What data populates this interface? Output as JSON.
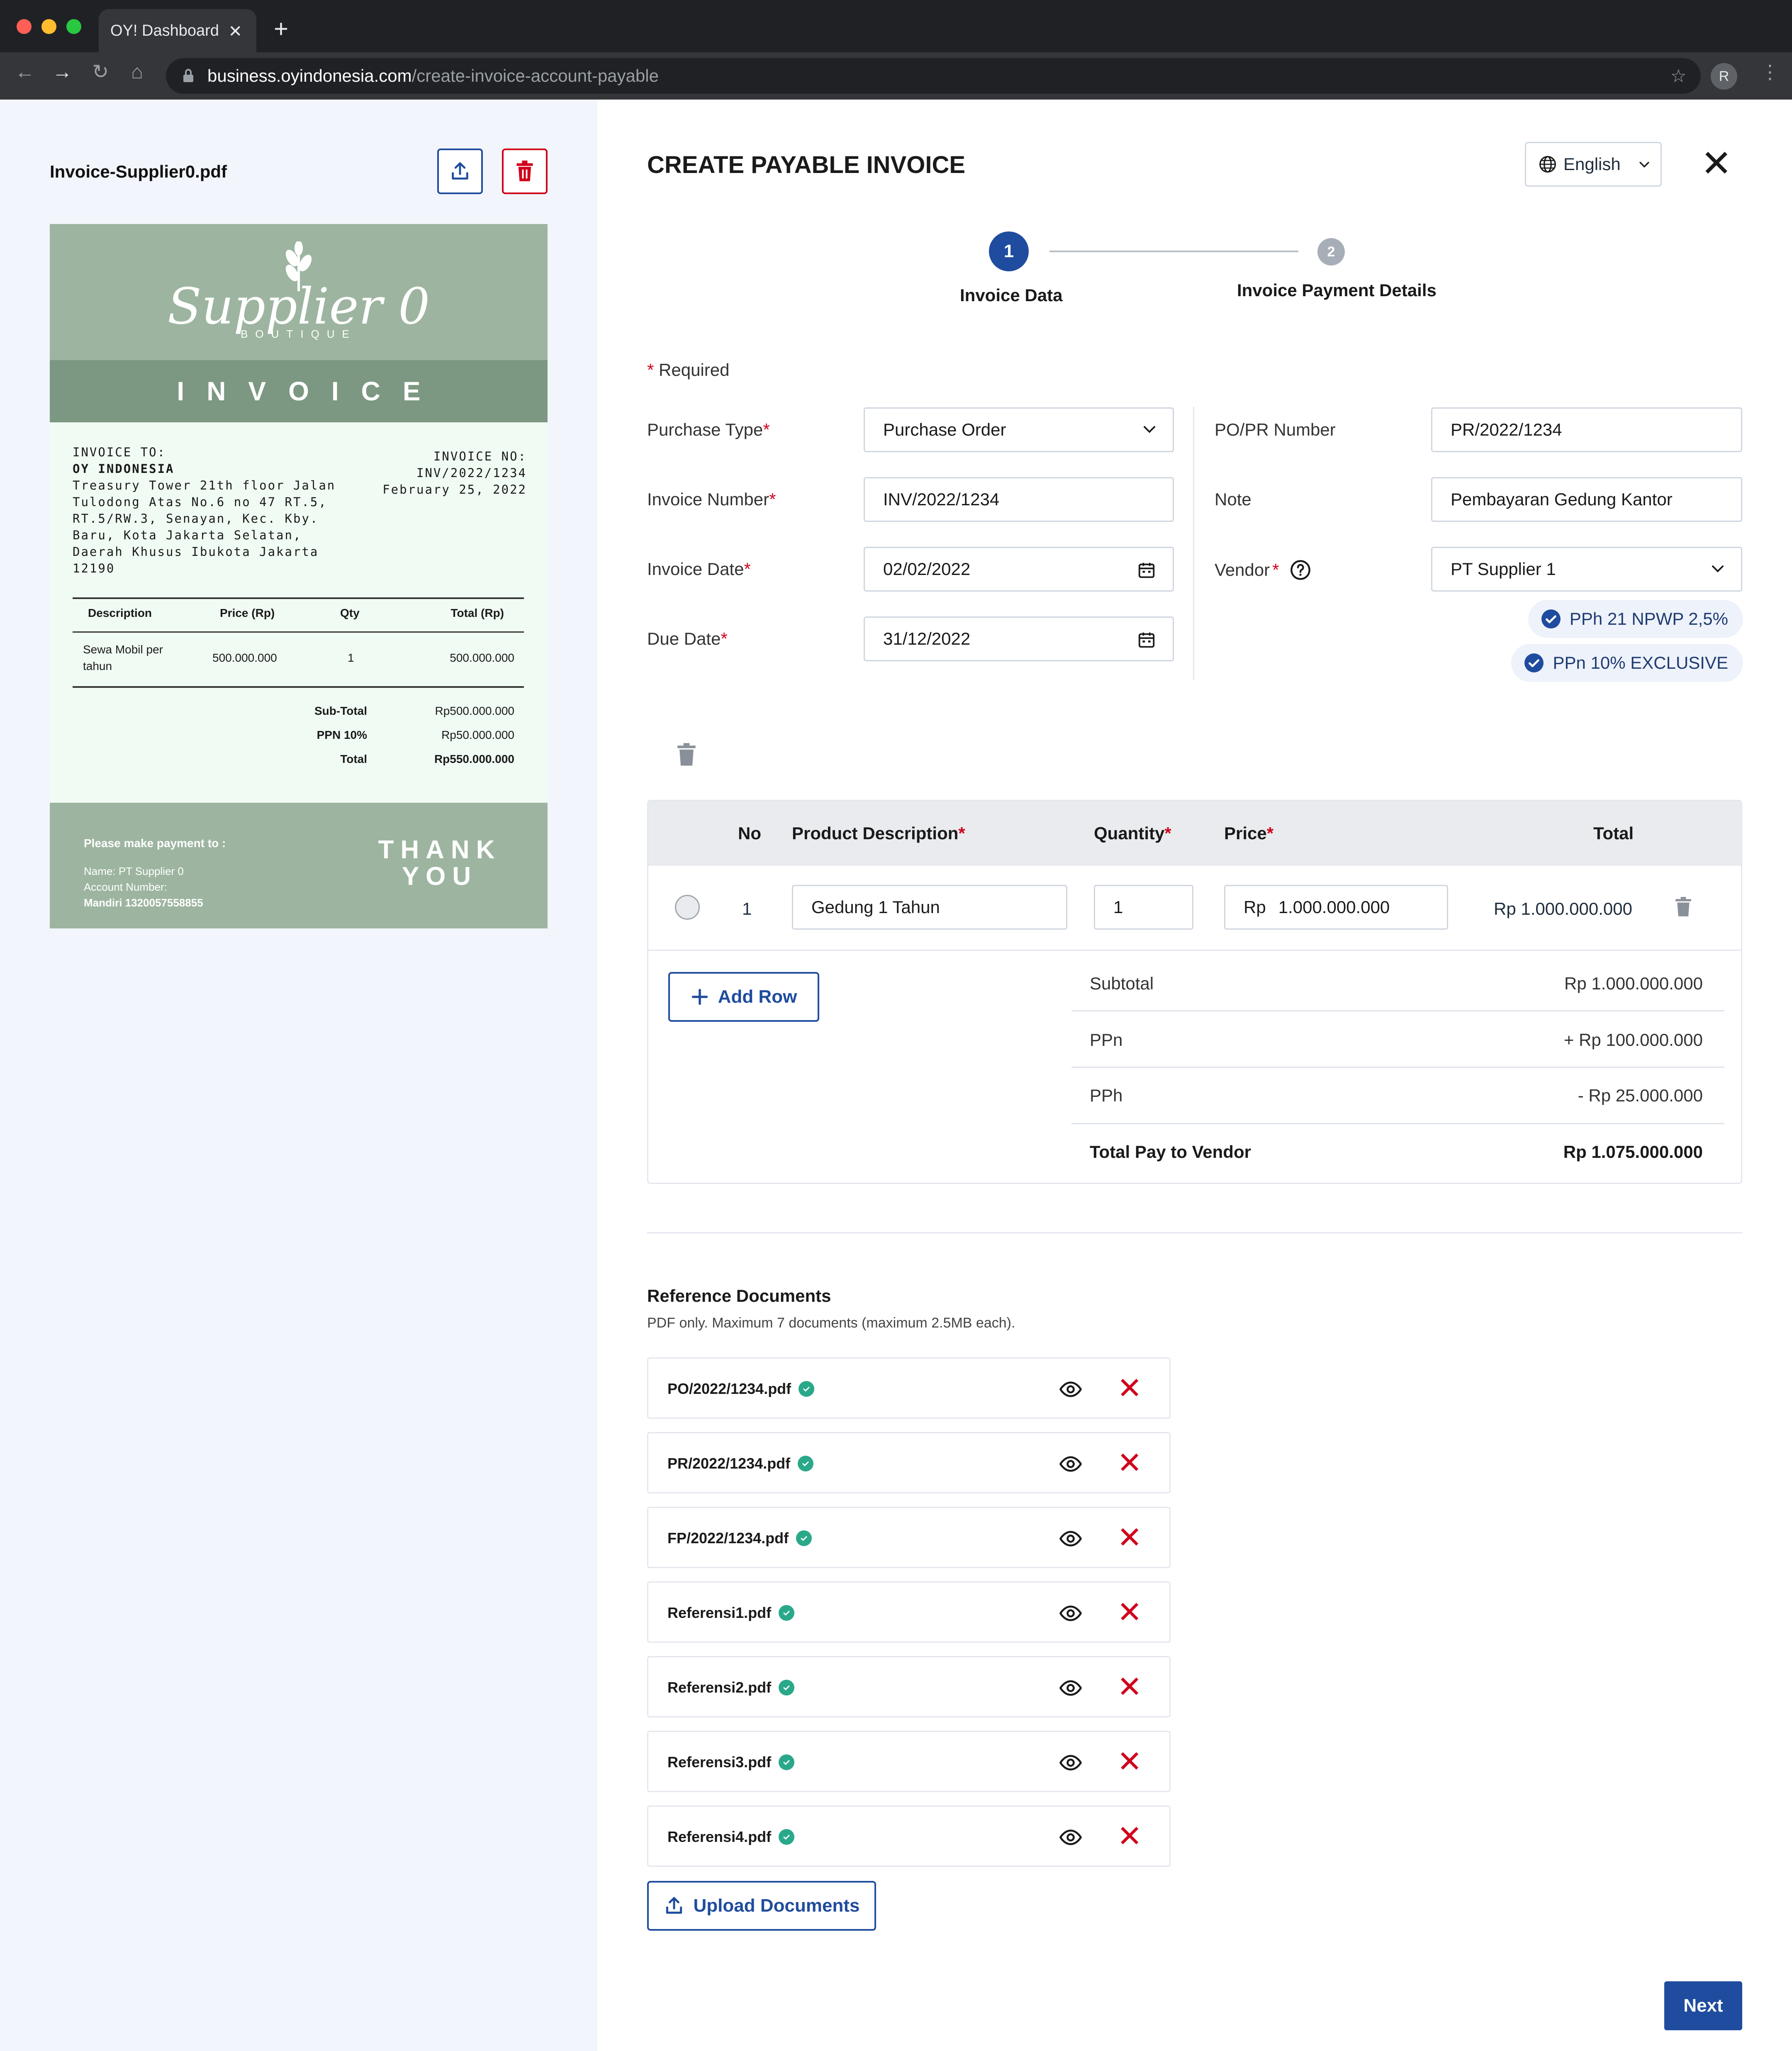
{
  "browser": {
    "tab_title": "OY! Dashboard",
    "url_host": "business.oyindonesia.com",
    "url_path": "/create-invoice-account-payable",
    "profile_initial": "R"
  },
  "preview": {
    "filename": "Invoice-Supplier0.pdf",
    "invoice": {
      "logo_text": "Supplier 0",
      "logo_sub": "BOUTIQUE",
      "band_title": "INVOICE",
      "to_label": "INVOICE TO:",
      "to_name": "OY INDONESIA",
      "to_address": [
        "Treasury Tower 21th floor Jalan",
        "Tulodong Atas No.6 no 47 RT.5,",
        "RT.5/RW.3, Senayan, Kec. Kby.",
        "Baru, Kota Jakarta Selatan,",
        "Daerah Khusus Ibukota Jakarta",
        "12190"
      ],
      "no_label": "INVOICE NO:",
      "no_value": "INV/2022/1234",
      "date": "February 25, 2022",
      "columns": [
        "Description",
        "Price (Rp)",
        "Qty",
        "Total (Rp)"
      ],
      "item": {
        "desc_1": "Sewa Mobil per",
        "desc_2": "tahun",
        "price": "500.000.000",
        "qty": "1",
        "total": "500.000.000"
      },
      "subtotal_label": "Sub-Total",
      "subtotal_value": "Rp500.000.000",
      "ppn_label": "PPN 10%",
      "ppn_value": "Rp50.000.000",
      "total_label": "Total",
      "total_value": "Rp550.000.000",
      "pay_label": "Please make payment to :",
      "pay_name_label": "Name:",
      "pay_name": "PT Supplier 0",
      "pay_acc_label": "Account Number:",
      "pay_acc": "Mandiri 1320057558855",
      "thank_1": "THANK",
      "thank_2": "YOU"
    }
  },
  "form": {
    "title": "CREATE PAYABLE INVOICE",
    "language": "English",
    "steps": [
      {
        "number": "1",
        "label": "Invoice Data",
        "active": true
      },
      {
        "number": "2",
        "label": "Invoice Payment Details",
        "active": false
      }
    ],
    "required_note": "Required",
    "fields": {
      "purchase_type": {
        "label": "Purchase Type",
        "value": "Purchase Order"
      },
      "invoice_number": {
        "label": "Invoice Number",
        "value": "INV/2022/1234"
      },
      "invoice_date": {
        "label": "Invoice Date",
        "value": "02/02/2022"
      },
      "due_date": {
        "label": "Due Date",
        "value": "31/12/2022"
      },
      "po_pr_number": {
        "label": "PO/PR Number",
        "value": "PR/2022/1234"
      },
      "note": {
        "label": "Note",
        "value": "Pembayaran Gedung Kantor"
      },
      "vendor": {
        "label": "Vendor",
        "value": "PT Supplier 1"
      }
    },
    "tax_chips": [
      "PPh 21 NPWP 2,5%",
      "PPn 10% EXCLUSIVE"
    ],
    "table": {
      "headers": {
        "no": "No",
        "desc": "Product Description",
        "qty": "Quantity",
        "price": "Price",
        "total": "Total"
      },
      "rows": [
        {
          "no": "1",
          "desc": "Gedung 1 Tahun",
          "qty": "1",
          "currency": "Rp",
          "price": "1.000.000.000",
          "total": "Rp 1.000.000.000"
        }
      ],
      "add_row": "Add Row",
      "summary": {
        "subtotal_label": "Subtotal",
        "subtotal_value": "Rp 1.000.000.000",
        "ppn_label": "PPn",
        "ppn_value": "+ Rp 100.000.000",
        "pph_label": "PPh",
        "pph_value": "- Rp 25.000.000",
        "total_label": "Total Pay to Vendor",
        "total_value": "Rp 1.075.000.000"
      }
    },
    "reference": {
      "title": "Reference Documents",
      "subtitle": "PDF only. Maximum 7 documents (maximum 2.5MB each).",
      "documents": [
        "PO/2022/1234.pdf",
        "PR/2022/1234.pdf",
        "FP/2022/1234.pdf",
        "Referensi1.pdf",
        "Referensi2.pdf",
        "Referensi3.pdf",
        "Referensi4.pdf"
      ],
      "upload_label": "Upload Documents"
    },
    "next_label": "Next"
  },
  "colors": {
    "primary": "#1f4c9e",
    "danger": "#d0021b",
    "success": "#2aa88a",
    "invoice_green": "#9db5a0"
  }
}
